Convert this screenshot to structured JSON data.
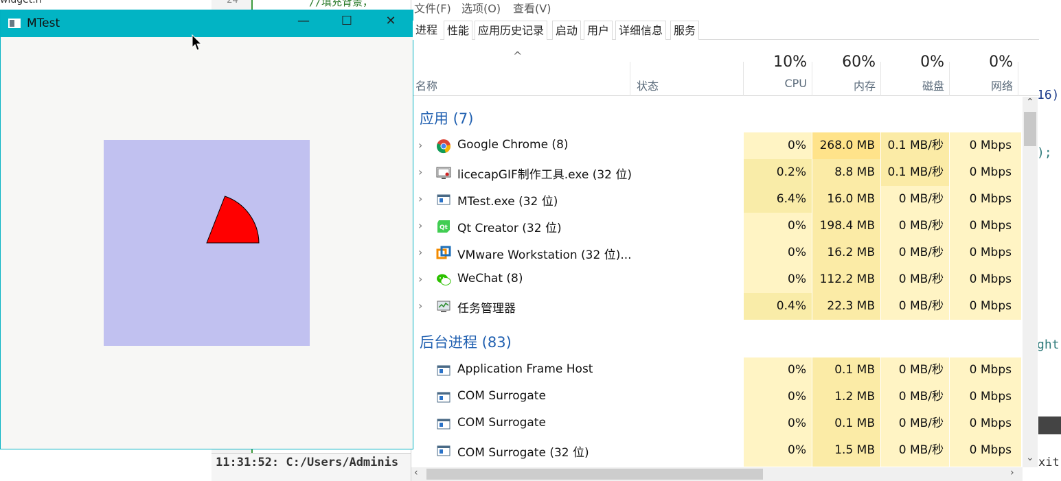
{
  "editor": {
    "top_tab": "widget.h",
    "line_number": "24",
    "code_top": "//填充背景，",
    "right_snippets": [
      "16)",
      ");",
      "ght"
    ],
    "status_log": "11:31:52: C:/Users/Adminis",
    "right_status": "xit"
  },
  "mtest": {
    "title": "MTest",
    "minimize": "—",
    "maximize": "☐",
    "close": "✕",
    "canvas_color": "#c1c1f0",
    "pie_color": "#ff0000"
  },
  "taskmgr": {
    "menu": [
      "文件(F)",
      "选项(O)",
      "查看(V)"
    ],
    "tabs": [
      "进程",
      "性能",
      "应用历史记录",
      "启动",
      "用户",
      "详细信息",
      "服务"
    ],
    "columns": {
      "name": "名称",
      "status": "状态",
      "cpu_pct": "10%",
      "cpu": "CPU",
      "mem_pct": "60%",
      "mem": "内存",
      "disk_pct": "0%",
      "disk": "磁盘",
      "net_pct": "0%",
      "net": "网络"
    },
    "groups": {
      "apps": "应用 (7)",
      "background": "后台进程 (83)"
    },
    "apps": [
      {
        "name": "Google Chrome (8)",
        "icon": "chrome-icon",
        "cpu": "0%",
        "mem": "268.0 MB",
        "disk": "0.1 MB/秒",
        "net": "0 Mbps"
      },
      {
        "name": "licecapGIF制作工具.exe (32 位)",
        "icon": "licecap-icon",
        "cpu": "0.2%",
        "mem": "8.8 MB",
        "disk": "0.1 MB/秒",
        "net": "0 Mbps"
      },
      {
        "name": "MTest.exe (32 位)",
        "icon": "app-window-icon",
        "cpu": "6.4%",
        "mem": "16.0 MB",
        "disk": "0 MB/秒",
        "net": "0 Mbps"
      },
      {
        "name": "Qt Creator (32 位)",
        "icon": "qt-icon",
        "cpu": "0%",
        "mem": "198.4 MB",
        "disk": "0 MB/秒",
        "net": "0 Mbps"
      },
      {
        "name": "VMware Workstation (32 位)...",
        "icon": "vmware-icon",
        "cpu": "0%",
        "mem": "16.2 MB",
        "disk": "0 MB/秒",
        "net": "0 Mbps"
      },
      {
        "name": "WeChat (8)",
        "icon": "wechat-icon",
        "cpu": "0%",
        "mem": "112.2 MB",
        "disk": "0 MB/秒",
        "net": "0 Mbps"
      },
      {
        "name": "任务管理器",
        "icon": "task-manager-icon",
        "cpu": "0.4%",
        "mem": "22.3 MB",
        "disk": "0 MB/秒",
        "net": "0 Mbps"
      }
    ],
    "background": [
      {
        "name": "Application Frame Host",
        "icon": "app-window-icon",
        "cpu": "0%",
        "mem": "0.1 MB",
        "disk": "0 MB/秒",
        "net": "0 Mbps"
      },
      {
        "name": "COM Surrogate",
        "icon": "app-window-icon",
        "cpu": "0%",
        "mem": "1.2 MB",
        "disk": "0 MB/秒",
        "net": "0 Mbps"
      },
      {
        "name": "COM Surrogate",
        "icon": "app-window-icon",
        "cpu": "0%",
        "mem": "0.1 MB",
        "disk": "0 MB/秒",
        "net": "0 Mbps"
      },
      {
        "name": "COM Surrogate (32 位)",
        "icon": "app-window-icon",
        "cpu": "0%",
        "mem": "1.5 MB",
        "disk": "0 MB/秒",
        "net": "0 Mbps"
      }
    ],
    "colors": {
      "heat_light": "#fff4c4",
      "heat_mid": "#f9eca8",
      "heat_strong": "#ffe38a",
      "group": "#1f5fb0"
    }
  }
}
